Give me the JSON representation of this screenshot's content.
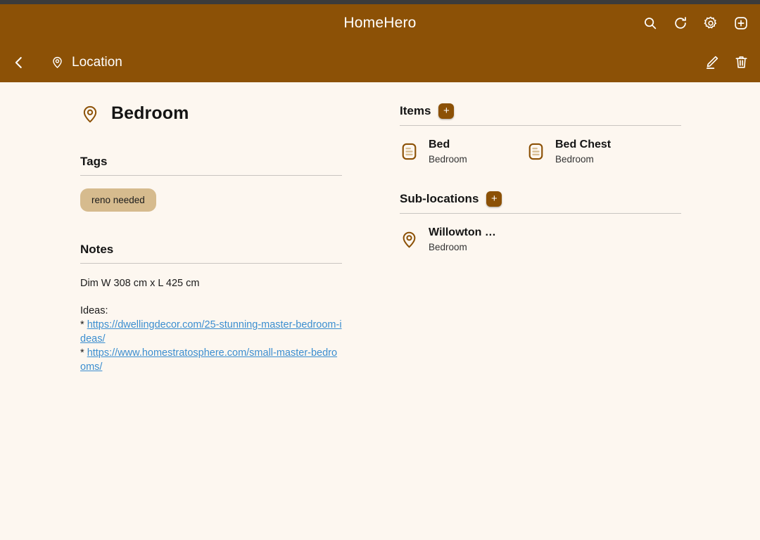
{
  "theme": {
    "brand_brown": "#8c5106",
    "background": "#fdf7f0",
    "tag_tan": "#d6bb8e",
    "link_blue": "#3b8ed0",
    "rule_gray": "#c9c5c1",
    "status_bar": "#3b3b3b"
  },
  "app_bar": {
    "title": "HomeHero",
    "actions": [
      {
        "name": "search-icon",
        "label": "Search"
      },
      {
        "name": "refresh-icon",
        "label": "Refresh"
      },
      {
        "name": "gear-icon",
        "label": "Settings"
      },
      {
        "name": "add-icon",
        "label": "Add"
      }
    ]
  },
  "sub_bar": {
    "back_label": "Back",
    "pin_icon": "location-pin-icon",
    "title": "Location",
    "actions": [
      {
        "name": "edit-icon",
        "label": "Edit"
      },
      {
        "name": "delete-icon",
        "label": "Delete"
      }
    ]
  },
  "location": {
    "pin_icon": "location-pin-icon",
    "name": "Bedroom"
  },
  "tags": {
    "heading": "Tags",
    "chips": [
      "reno needed"
    ]
  },
  "notes": {
    "heading": "Notes",
    "dimensions_line": "Dim W 308 cm x L 425 cm",
    "ideas_label": "Ideas:",
    "bullet": "*",
    "links": [
      "https://dwellingdecor.com/25-stunning-master-bedroom-ideas/",
      "https://www.homestratosphere.com/small-master-bedrooms/"
    ]
  },
  "items": {
    "heading": "Items",
    "add_label": "+",
    "list": [
      {
        "icon": "item-card-icon",
        "name": "Bed",
        "sub": "Bedroom"
      },
      {
        "icon": "item-card-icon",
        "name": "Bed Chest",
        "sub": "Bedroom"
      }
    ]
  },
  "sublocations": {
    "heading": "Sub-locations",
    "add_label": "+",
    "list": [
      {
        "icon": "location-pin-icon",
        "name": "Willowton …",
        "sub": "Bedroom"
      }
    ]
  }
}
